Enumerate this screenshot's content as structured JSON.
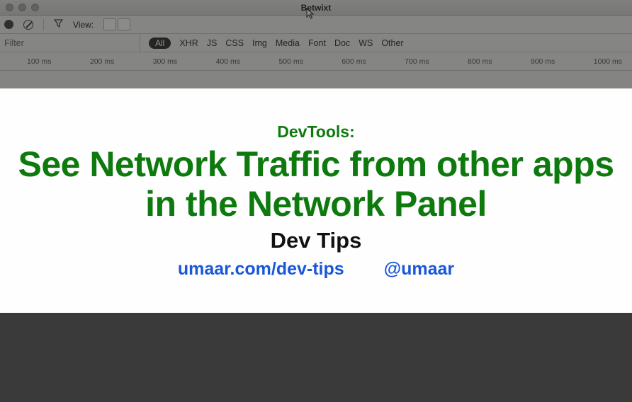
{
  "window": {
    "title": "Betwixt"
  },
  "toolbar": {
    "view_label": "View:"
  },
  "filter": {
    "placeholder": "Filter",
    "types": {
      "all": "All",
      "xhr": "XHR",
      "js": "JS",
      "css": "CSS",
      "img": "Img",
      "media": "Media",
      "font": "Font",
      "doc": "Doc",
      "ws": "WS",
      "other": "Other"
    }
  },
  "timescale": [
    "100 ms",
    "200 ms",
    "300 ms",
    "400 ms",
    "500 ms",
    "600 ms",
    "700 ms",
    "800 ms",
    "900 ms",
    "1000 ms"
  ],
  "overlay": {
    "kicker": "DevTools:",
    "title": "See Network Traffic from other apps in the Network Panel",
    "subtitle": "Dev Tips",
    "link_site": "umaar.com/dev-tips",
    "link_handle": "@umaar"
  }
}
